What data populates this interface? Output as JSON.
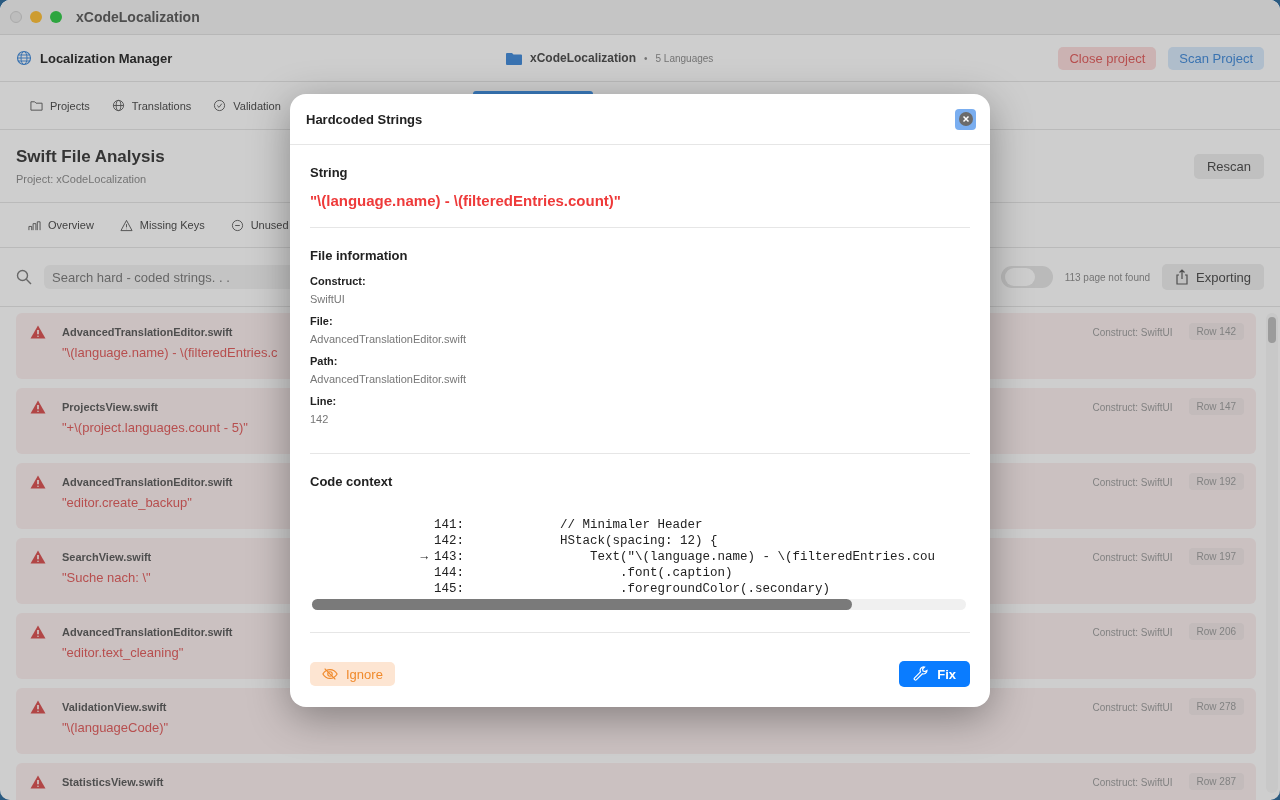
{
  "window": {
    "title": "xCodeLocalization"
  },
  "header": {
    "app_name": "Localization Manager",
    "project": "xCodeLocalization",
    "separator": "•",
    "languages": "5 Languages",
    "buttons": [
      {
        "label": "Close project",
        "kind": "danger"
      },
      {
        "label": "Scan Project",
        "kind": "primary"
      }
    ]
  },
  "nav_tabs": [
    {
      "label": "Projects",
      "selected": false
    },
    {
      "label": "Translations",
      "selected": false
    },
    {
      "label": "Validation",
      "selected": false
    },
    {
      "selected": true
    }
  ],
  "page": {
    "title": "Swift File Analysis",
    "subtitle": "Project: xCodeLocalization",
    "rescan": "Rescan"
  },
  "sub_tabs": [
    {
      "label": "Overview"
    },
    {
      "label": "Missing Keys"
    },
    {
      "label": "Unused"
    }
  ],
  "toolbar": {
    "search_placeholder": "Search hard - coded strings. . .",
    "toggle_on": false,
    "status": "113 page not found",
    "export": "Exporting"
  },
  "results": [
    {
      "file": "AdvancedTranslationEditor.swift",
      "string": "\"\\(language.name) - \\(filteredEntries.c",
      "construct": "Construct: SwiftUI",
      "row": "Row 142"
    },
    {
      "file": "ProjectsView.swift",
      "string": "\"+\\(project.languages.count - 5)\"",
      "construct": "Construct: SwiftUI",
      "row": "Row 147"
    },
    {
      "file": "AdvancedTranslationEditor.swift",
      "string": "\"editor.create_backup\"",
      "construct": "Construct: SwiftUI",
      "row": "Row 192"
    },
    {
      "file": "SearchView.swift",
      "string": "\"Suche nach: \\\"",
      "construct": "Construct: SwiftUI",
      "row": "Row 197"
    },
    {
      "file": "AdvancedTranslationEditor.swift",
      "string": "\"editor.text_cleaning\"",
      "construct": "Construct: SwiftUI",
      "row": "Row 206"
    },
    {
      "file": "ValidationView.swift",
      "string": "\"\\(languageCode)\"",
      "construct": "Construct: SwiftUI",
      "row": "Row 278"
    },
    {
      "file": "StatisticsView.swift",
      "construct": "Construct: SwiftUI",
      "row": "Row 287"
    }
  ],
  "dialog": {
    "title": "Hardcoded Strings",
    "string_heading": "String",
    "string_value": "\"\\(language.name) - \\(filteredEntries.count)\"",
    "file_heading": "File information",
    "fields": [
      {
        "label": "Construct:",
        "value": "SwiftUI"
      },
      {
        "label": "File:",
        "value": "AdvancedTranslationEditor.swift"
      },
      {
        "label": "Path:",
        "value": "AdvancedTranslationEditor.swift"
      },
      {
        "label": "Line:",
        "value": "142"
      }
    ],
    "code_heading": "Code context",
    "code_lines": [
      {
        "number": "141:",
        "code": "            // Minimaler Header"
      },
      {
        "number": "142:",
        "code": "            HStack(spacing: 12) {"
      },
      {
        "number": "143:",
        "code": "                Text(\"\\(language.name) - \\(filteredEntries.cou",
        "marker": "→"
      },
      {
        "number": "144:",
        "code": "                    .font(.caption)"
      },
      {
        "number": "145:",
        "code": "                    .foregroundColor(.secondary)"
      }
    ],
    "ignore": "Ignore",
    "fix": "Fix"
  }
}
